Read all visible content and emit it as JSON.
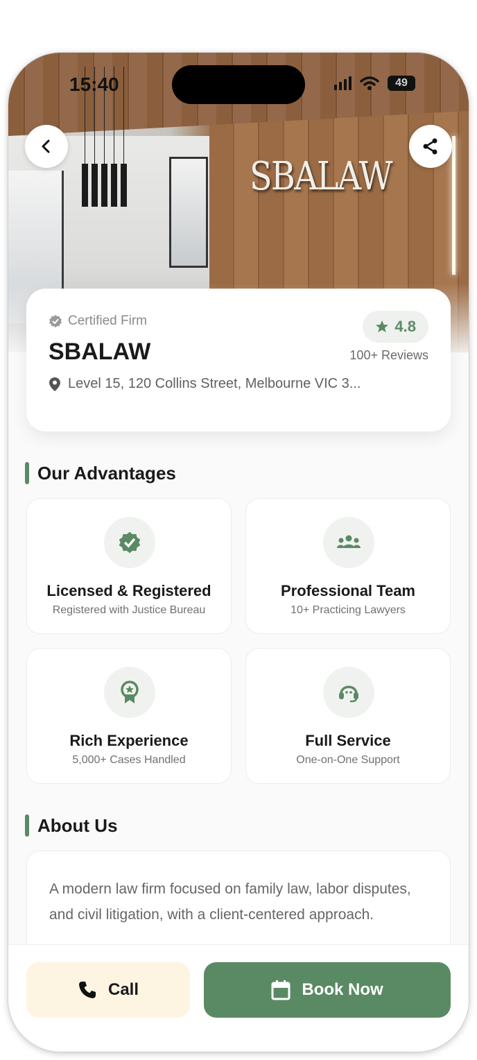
{
  "status_bar": {
    "time": "15:40",
    "battery": "49"
  },
  "hero": {
    "logo_text": "SBALAW",
    "back_icon": "chevron-left-icon",
    "share_icon": "share-icon"
  },
  "firm": {
    "badge": "Certified Firm",
    "name": "SBALAW",
    "rating": "4.8",
    "reviews": "100+ Reviews",
    "address": "Level 15, 120 Collins Street, Melbourne VIC 3..."
  },
  "advantages": {
    "title": "Our Advantages",
    "items": [
      {
        "title": "Licensed & Registered",
        "subtitle": "Registered with Justice Bureau",
        "icon": "verified-badge-icon"
      },
      {
        "title": "Professional Team",
        "subtitle": "10+ Practicing Lawyers",
        "icon": "team-icon"
      },
      {
        "title": "Rich Experience",
        "subtitle": "5,000+ Cases Handled",
        "icon": "award-ribbon-icon"
      },
      {
        "title": "Full Service",
        "subtitle": "One-on-One Support",
        "icon": "headset-icon"
      }
    ]
  },
  "about": {
    "title": "About Us",
    "text": "A modern law firm focused on family law, labor disputes, and civil litigation, with a client-centered approach."
  },
  "actions": {
    "call_label": "Call",
    "book_label": "Book Now"
  },
  "colors": {
    "accent": "#5a8a64",
    "call_bg": "#fdf4e2"
  }
}
